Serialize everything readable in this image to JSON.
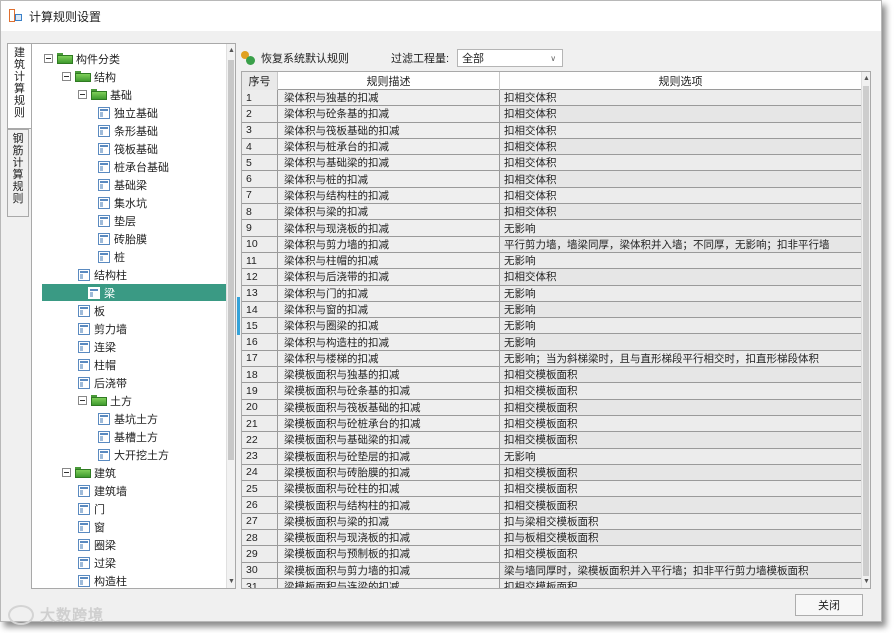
{
  "window": {
    "title": "计算规则设置"
  },
  "side_tabs": [
    {
      "label": "建筑计算规则",
      "active": true
    },
    {
      "label": "钢筋计算规则",
      "active": false
    }
  ],
  "tree": {
    "root": "构件分类",
    "structure": "结构",
    "foundation": "基础",
    "foundation_items": [
      "独立基础",
      "条形基础",
      "筏板基础",
      "桩承台基础",
      "基础梁",
      "集水坑",
      "垫层",
      "砖胎膜",
      "桩"
    ],
    "structure_items": [
      "结构柱",
      "梁",
      "板",
      "剪力墙",
      "连梁",
      "柱帽",
      "后浇带"
    ],
    "selected": "梁",
    "earthwork": "土方",
    "earthwork_items": [
      "基坑土方",
      "基槽土方",
      "大开挖土方"
    ],
    "architecture": "建筑",
    "architecture_items": [
      "建筑墙",
      "门",
      "窗",
      "圈梁",
      "过梁",
      "构造柱"
    ]
  },
  "toolbar": {
    "restore_label": "恢复系统默认规则",
    "filter_label": "过滤工程量:",
    "filter_value": "全部"
  },
  "grid": {
    "columns": [
      "序号",
      "规则描述",
      "规则选项"
    ],
    "rows": [
      [
        "1",
        "梁体积与独基的扣减",
        "扣相交体积"
      ],
      [
        "2",
        "梁体积与砼条基的扣减",
        "扣相交体积"
      ],
      [
        "3",
        "梁体积与筏板基础的扣减",
        "扣相交体积"
      ],
      [
        "4",
        "梁体积与桩承台的扣减",
        "扣相交体积"
      ],
      [
        "5",
        "梁体积与基础梁的扣减",
        "扣相交体积"
      ],
      [
        "6",
        "梁体积与桩的扣减",
        "扣相交体积"
      ],
      [
        "7",
        "梁体积与结构柱的扣减",
        "扣相交体积"
      ],
      [
        "8",
        "梁体积与梁的扣减",
        "扣相交体积"
      ],
      [
        "9",
        "梁体积与现浇板的扣减",
        "无影响"
      ],
      [
        "10",
        "梁体积与剪力墙的扣减",
        "平行剪力墙，墙梁同厚，梁体积并入墙；不同厚，无影响；扣非平行墙"
      ],
      [
        "11",
        "梁体积与柱帽的扣减",
        "无影响"
      ],
      [
        "12",
        "梁体积与后浇带的扣减",
        "扣相交体积"
      ],
      [
        "13",
        "梁体积与门的扣减",
        "无影响"
      ],
      [
        "14",
        "梁体积与窗的扣减",
        "无影响"
      ],
      [
        "15",
        "梁体积与圈梁的扣减",
        "无影响"
      ],
      [
        "16",
        "梁体积与构造柱的扣减",
        "无影响"
      ],
      [
        "17",
        "梁体积与楼梯的扣减",
        "无影响；当为斜梯梁时，且与直形梯段平行相交时，扣直形梯段体积"
      ],
      [
        "18",
        "梁模板面积与独基的扣减",
        "扣相交模板面积"
      ],
      [
        "19",
        "梁模板面积与砼条基的扣减",
        "扣相交模板面积"
      ],
      [
        "20",
        "梁模板面积与筏板基础的扣减",
        "扣相交模板面积"
      ],
      [
        "21",
        "梁模板面积与砼桩承台的扣减",
        "扣相交模板面积"
      ],
      [
        "22",
        "梁模板面积与基础梁的扣减",
        "扣相交模板面积"
      ],
      [
        "23",
        "梁模板面积与砼垫层的扣减",
        "无影响"
      ],
      [
        "24",
        "梁模板面积与砖胎膜的扣减",
        "扣相交模板面积"
      ],
      [
        "25",
        "梁模板面积与砼柱的扣减",
        "扣相交模板面积"
      ],
      [
        "26",
        "梁模板面积与结构柱的扣减",
        "扣相交模板面积"
      ],
      [
        "27",
        "梁模板面积与梁的扣减",
        "扣与梁相交模板面积"
      ],
      [
        "28",
        "梁模板面积与现浇板的扣减",
        "扣与板相交模板面积"
      ],
      [
        "29",
        "梁模板面积与预制板的扣减",
        "扣相交模板面积"
      ],
      [
        "30",
        "梁模板面积与剪力墙的扣减",
        "梁与墙同厚时，梁模板面积并入平行墙；扣非平行剪力墙模板面积"
      ],
      [
        "31",
        "梁模板面积与连梁的扣减",
        "扣相交模板面积"
      ]
    ]
  },
  "footer": {
    "close_label": "关闭"
  },
  "watermark": {
    "text": "大数跨境"
  },
  "colors": {
    "selection": "#3a9a84",
    "folder": "#5cb541",
    "row_marker": "#36a3d9"
  }
}
